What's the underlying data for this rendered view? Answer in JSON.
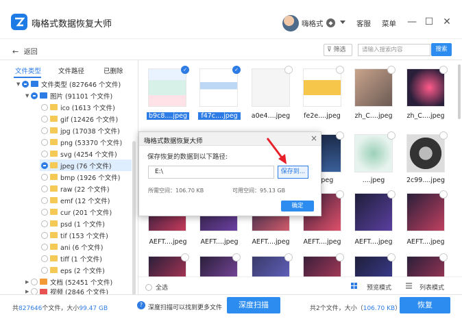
{
  "app": {
    "title": "嗨格式数据恢复大师",
    "accent": "#2d7be5"
  },
  "header": {
    "username": "嗨格式",
    "service": "客服",
    "menu": "菜单"
  },
  "toolbar": {
    "back": "返回",
    "filter": "筛选",
    "search_placeholder": "请输入搜索内容",
    "search_btn": "搜索"
  },
  "sidebar": {
    "tabs": [
      "文件类型",
      "文件路径",
      "已删除"
    ],
    "tree": [
      {
        "label": "文件类型 (827646 个文件)"
      },
      {
        "label": "图片 (91101 个文件)"
      },
      {
        "label": "ico (1613 个文件)"
      },
      {
        "label": "gif (12426 个文件)"
      },
      {
        "label": "jpg (17038 个文件)"
      },
      {
        "label": "png (53370 个文件)"
      },
      {
        "label": "svg (4254 个文件)"
      },
      {
        "label": "jpeg (76 个文件)"
      },
      {
        "label": "bmp (1926 个文件)"
      },
      {
        "label": "raw (22 个文件)"
      },
      {
        "label": "emf (12 个文件)"
      },
      {
        "label": "cur (201 个文件)"
      },
      {
        "label": "psd (1 个文件)"
      },
      {
        "label": "tif (153 个文件)"
      },
      {
        "label": "ani (6 个文件)"
      },
      {
        "label": "tiff (1 个文件)"
      },
      {
        "label": "eps (2 个文件)"
      },
      {
        "label": "文档 (52451 个文件)"
      },
      {
        "label": "视频 (2846 个文件)"
      }
    ]
  },
  "grid": {
    "row1": [
      "b9c8....jpeg",
      "f47c....jpeg",
      "a0e4....jpeg",
      "fe2e....jpeg",
      "zh_C....jpeg",
      "zh_C....jpeg"
    ],
    "row2": [
      "....jpeg",
      "....jpeg",
      "2c99....jpeg"
    ],
    "row3": [
      "AEFT....jpeg",
      "AEFT....jpeg",
      "AEFT....jpeg",
      "AEFT....jpeg",
      "AEFT....jpeg",
      "AEFT....jpeg"
    ]
  },
  "bottom": {
    "select_all": "全选",
    "preview_mode": "预览模式",
    "list_mode": "列表模式"
  },
  "footer": {
    "total_prefix": "共",
    "total_count": "827646",
    "total_mid": "个文件，大小",
    "total_size": "99.47 GB",
    "help": "深度扫描可以找到更多文件",
    "deep_scan": "深度扫描",
    "sel_prefix": "共2个文件，大小（",
    "sel_size": "106.70 KB",
    "sel_suffix": "）",
    "recover": "恢复"
  },
  "dialog": {
    "title": "嗨格式数据恢复大师",
    "label": "保存恢复的数据到以下路径:",
    "path": "E:\\",
    "save_to": "保存到...",
    "need_space": "所需空间：106.70 KB",
    "free_space": "可用空间：95.13 GB",
    "ok": "确定"
  }
}
